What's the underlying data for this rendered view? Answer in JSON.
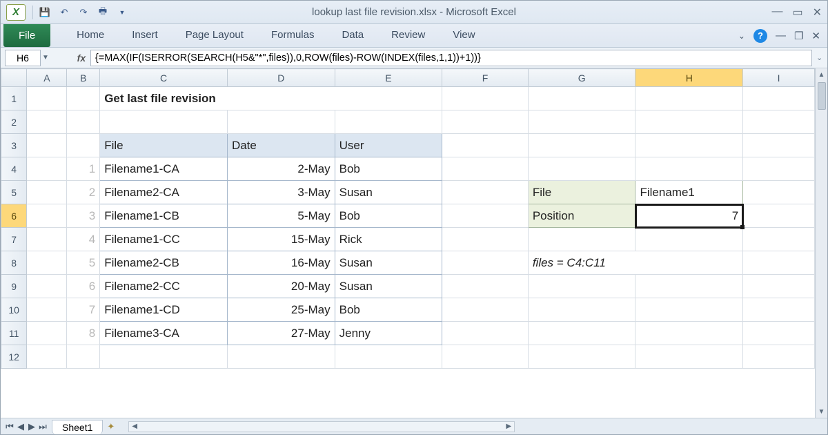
{
  "titlebar": {
    "title": "lookup last file revision.xlsx  -  Microsoft Excel"
  },
  "ribbon": {
    "file": "File",
    "tabs": [
      "Home",
      "Insert",
      "Page Layout",
      "Formulas",
      "Data",
      "Review",
      "View"
    ]
  },
  "namebox": "H6",
  "formula": "{=MAX(IF(ISERROR(SEARCH(H5&\"*\",files)),0,ROW(files)-ROW(INDEX(files,1,1))+1))}",
  "columns": [
    "A",
    "B",
    "C",
    "D",
    "E",
    "F",
    "G",
    "H",
    "I"
  ],
  "activeCol": "H",
  "activeRow": 6,
  "headings": {
    "title": "Get last file revision",
    "file": "File",
    "date": "Date",
    "user": "User"
  },
  "table": [
    {
      "n": 1,
      "file": "Filename1-CA",
      "date": "2-May",
      "user": "Bob"
    },
    {
      "n": 2,
      "file": "Filename2-CA",
      "date": "3-May",
      "user": "Susan"
    },
    {
      "n": 3,
      "file": "Filename1-CB",
      "date": "5-May",
      "user": "Bob"
    },
    {
      "n": 4,
      "file": "Filename1-CC",
      "date": "15-May",
      "user": "Rick"
    },
    {
      "n": 5,
      "file": "Filename2-CB",
      "date": "16-May",
      "user": "Susan"
    },
    {
      "n": 6,
      "file": "Filename2-CC",
      "date": "20-May",
      "user": "Susan"
    },
    {
      "n": 7,
      "file": "Filename1-CD",
      "date": "25-May",
      "user": "Bob"
    },
    {
      "n": 8,
      "file": "Filename3-CA",
      "date": "27-May",
      "user": "Jenny"
    }
  ],
  "lookup": {
    "fileLabel": "File",
    "fileValue": "Filename1",
    "posLabel": "Position",
    "posValue": "7"
  },
  "note": "files = C4:C11",
  "sheet": "Sheet1"
}
